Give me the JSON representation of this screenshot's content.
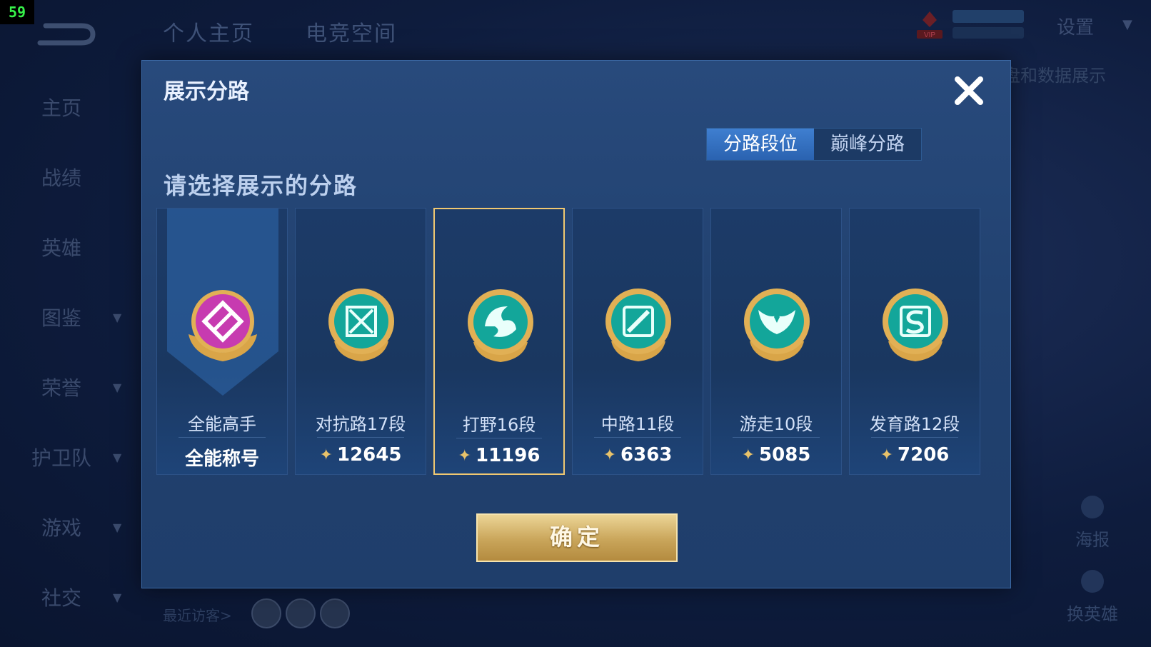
{
  "fps": "59",
  "top_tabs": [
    "个人主页",
    "电竞空间"
  ],
  "sidebar": {
    "items": [
      {
        "label": "主页"
      },
      {
        "label": "战绩"
      },
      {
        "label": "英雄"
      },
      {
        "label": "图鉴"
      },
      {
        "label": "荣誉"
      },
      {
        "label": "护卫队"
      },
      {
        "label": "游戏"
      },
      {
        "label": "社交"
      }
    ]
  },
  "header": {
    "settings_label": "设置",
    "vip_label": "VIP"
  },
  "background_text": "盘和数据展示",
  "right_side": {
    "poster_label": "海报",
    "switch_hero_label": "换英雄"
  },
  "visitors_label": "最近访客>",
  "modal": {
    "title": "展示分路",
    "toggle": {
      "active": "分路段位",
      "inactive": "巅峰分路"
    },
    "subtitle": "请选择展示的分路",
    "confirm_label": "确定",
    "cards": [
      {
        "name": "全能高手",
        "score": "全能称号",
        "color": "#c73bb0"
      },
      {
        "name": "对抗路17段",
        "score": "12645",
        "color": "#13a69a"
      },
      {
        "name": "打野16段",
        "score": "11196",
        "color": "#13a69a"
      },
      {
        "name": "中路11段",
        "score": "6363",
        "color": "#13a69a"
      },
      {
        "name": "游走10段",
        "score": "5085",
        "color": "#13a69a"
      },
      {
        "name": "发育路12段",
        "score": "7206",
        "color": "#13a69a"
      }
    ]
  }
}
